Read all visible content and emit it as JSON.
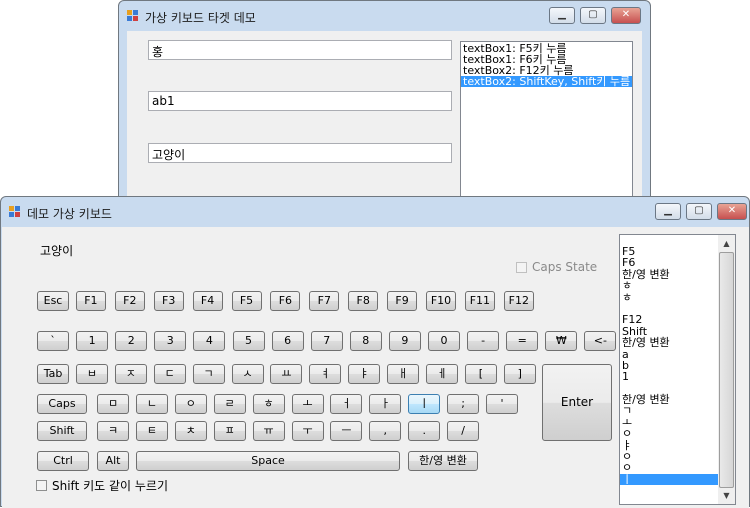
{
  "target_window": {
    "title": "가상 키보드 타겟 데모",
    "textboxes": [
      "홍",
      "ab1",
      "고양이"
    ],
    "log": [
      {
        "text": "textBox1: F5키 누름",
        "selected": false
      },
      {
        "text": "textBox1: F6키 누름",
        "selected": false
      },
      {
        "text": "textBox2: F12키 누름",
        "selected": false
      },
      {
        "text": "textBox2: ShiftKey, Shift키 누름",
        "selected": true
      }
    ]
  },
  "keyboard_window": {
    "title": "데모 가상 키보드",
    "display_text": "고양이",
    "caps_state_label": "Caps State",
    "shift_checkbox_label": "Shift 키도 같이 누르기",
    "rows": {
      "function": [
        "Esc",
        "F1",
        "F2",
        "F3",
        "F4",
        "F5",
        "F6",
        "F7",
        "F8",
        "F9",
        "F10",
        "F11",
        "F12"
      ],
      "number": [
        "`",
        "1",
        "2",
        "3",
        "4",
        "5",
        "6",
        "7",
        "8",
        "9",
        "0",
        "-",
        "=",
        "₩",
        "<-"
      ],
      "tab": [
        "Tab",
        "ㅂ",
        "ㅈ",
        "ㄷ",
        "ㄱ",
        "ㅅ",
        "ㅛ",
        "ㅕ",
        "ㅑ",
        "ㅐ",
        "ㅔ",
        "[",
        "]"
      ],
      "caps": [
        "Caps",
        "ㅁ",
        "ㄴ",
        "ㅇ",
        "ㄹ",
        "ㅎ",
        "ㅗ",
        "ㅓ",
        "ㅏ",
        "ㅣ",
        ";",
        "'"
      ],
      "shift": [
        "Shift",
        "ㅋ",
        "ㅌ",
        "ㅊ",
        "ㅍ",
        "ㅠ",
        "ㅜ",
        "ㅡ",
        ",",
        ".",
        "/"
      ],
      "bottom": [
        "Ctrl",
        "Alt",
        "Space",
        "한/영 변환"
      ]
    },
    "enter_label": "Enter",
    "key_log": [
      "F5",
      "F6",
      "한/영 변환",
      "ㅎ",
      "ㅎ",
      "",
      "F12",
      "Shift",
      "한/영 변환",
      "a",
      "b",
      "1",
      "",
      "한/영 변환",
      "ㄱ",
      "ㅗ",
      "ㅇ",
      "ㅑ",
      "ㅇ",
      "ㅇ",
      "ㅣ"
    ],
    "key_log_selected_index": 20
  },
  "colors": {
    "selection": "#3399ff",
    "close_button": "#c75050"
  }
}
